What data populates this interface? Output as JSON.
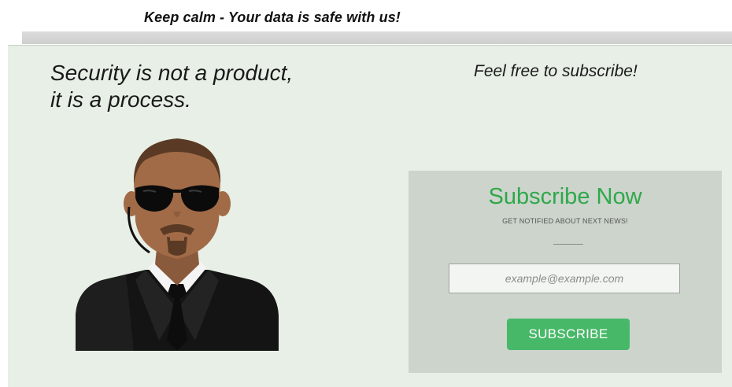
{
  "banner": {
    "text": "Keep calm - Your data is safe with us!"
  },
  "quote": {
    "line1": "Security is not a product,",
    "line2": "it is a process."
  },
  "invite": {
    "text": "Feel free to subscribe!"
  },
  "subscribe": {
    "title": "Subscribe Now",
    "subtitle": "GET NOTIFIED ABOUT NEXT NEWS!",
    "email_placeholder": "example@example.com",
    "email_value": "",
    "button_label": "SUBSCRIBE"
  },
  "icons": {
    "figure": "security-guard-icon"
  },
  "colors": {
    "accent_text": "#2fa84a",
    "button": "#47b868",
    "panel_bg": "#e7efe6",
    "subscribe_bg": "#ccd4cc"
  }
}
